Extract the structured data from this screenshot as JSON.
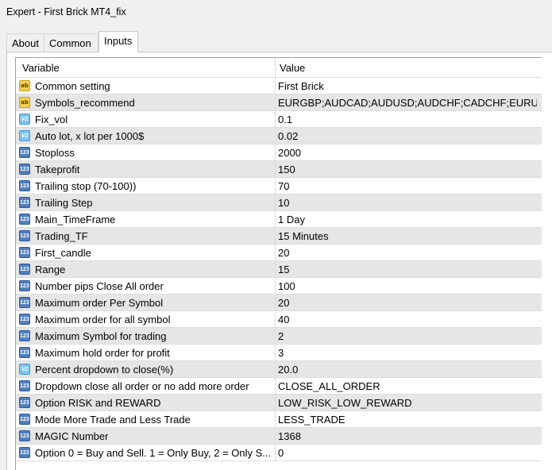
{
  "window": {
    "title": "Expert - First Brick MT4_fix"
  },
  "tabs": [
    {
      "label": "About"
    },
    {
      "label": "Common"
    },
    {
      "label": "Inputs"
    }
  ],
  "table": {
    "headers": {
      "variable": "Variable",
      "value": "Value"
    },
    "rows": [
      {
        "icon": "string-icon",
        "variable": "Common setting",
        "value": "First Brick"
      },
      {
        "icon": "string-icon",
        "variable": "Symbols_recommend",
        "value": "EURGBP;AUDCAD;AUDUSD;AUDCHF;CADCHF;EURUS..."
      },
      {
        "icon": "double-icon",
        "variable": "Fix_vol",
        "value": "0.1"
      },
      {
        "icon": "double-icon",
        "variable": "Auto lot, x lot per 1000$",
        "value": "0.02"
      },
      {
        "icon": "integer-icon",
        "variable": "Stoploss",
        "value": "2000"
      },
      {
        "icon": "integer-icon",
        "variable": "Takeprofit",
        "value": "150"
      },
      {
        "icon": "integer-icon",
        "variable": "Trailing stop (70-100))",
        "value": "70"
      },
      {
        "icon": "integer-icon",
        "variable": "Trailing Step",
        "value": "10"
      },
      {
        "icon": "integer-icon",
        "variable": "Main_TimeFrame",
        "value": "1 Day"
      },
      {
        "icon": "integer-icon",
        "variable": "Trading_TF",
        "value": "15 Minutes"
      },
      {
        "icon": "integer-icon",
        "variable": "First_candle",
        "value": "20"
      },
      {
        "icon": "integer-icon",
        "variable": "Range",
        "value": "15"
      },
      {
        "icon": "integer-icon",
        "variable": "Number pips Close All order",
        "value": "100"
      },
      {
        "icon": "integer-icon",
        "variable": "Maximum order Per Symbol",
        "value": "20"
      },
      {
        "icon": "integer-icon",
        "variable": "Maximum order for all symbol",
        "value": "40"
      },
      {
        "icon": "integer-icon",
        "variable": "Maximum Symbol for trading",
        "value": "2"
      },
      {
        "icon": "integer-icon",
        "variable": "Maximum hold order for profit",
        "value": "3"
      },
      {
        "icon": "double-icon",
        "variable": "Percent dropdown to close(%)",
        "value": "20.0"
      },
      {
        "icon": "integer-icon",
        "variable": "Dropdown close all order or no add more order",
        "value": "CLOSE_ALL_ORDER"
      },
      {
        "icon": "integer-icon",
        "variable": "Option RISK and REWARD",
        "value": "LOW_RISK_LOW_REWARD"
      },
      {
        "icon": "integer-icon",
        "variable": "Mode More Trade and Less Trade",
        "value": "LESS_TRADE"
      },
      {
        "icon": "integer-icon",
        "variable": "MAGIC Number",
        "value": "1368"
      },
      {
        "icon": "integer-icon",
        "variable": "Option 0 = Buy and Sell. 1 = Only Buy, 2 = Only S...",
        "value": "0"
      }
    ]
  },
  "icons": {
    "string-icon": {
      "glyph": "ab"
    },
    "integer-icon": {
      "glyph": "123"
    },
    "double-icon": {
      "glyph": "V2"
    }
  },
  "colors": {
    "alt_row": "#e6e6e6",
    "string_icon": "#f5d04a",
    "integer_icon": "#4f7fbf",
    "double_icon": "#7ec2ef"
  }
}
